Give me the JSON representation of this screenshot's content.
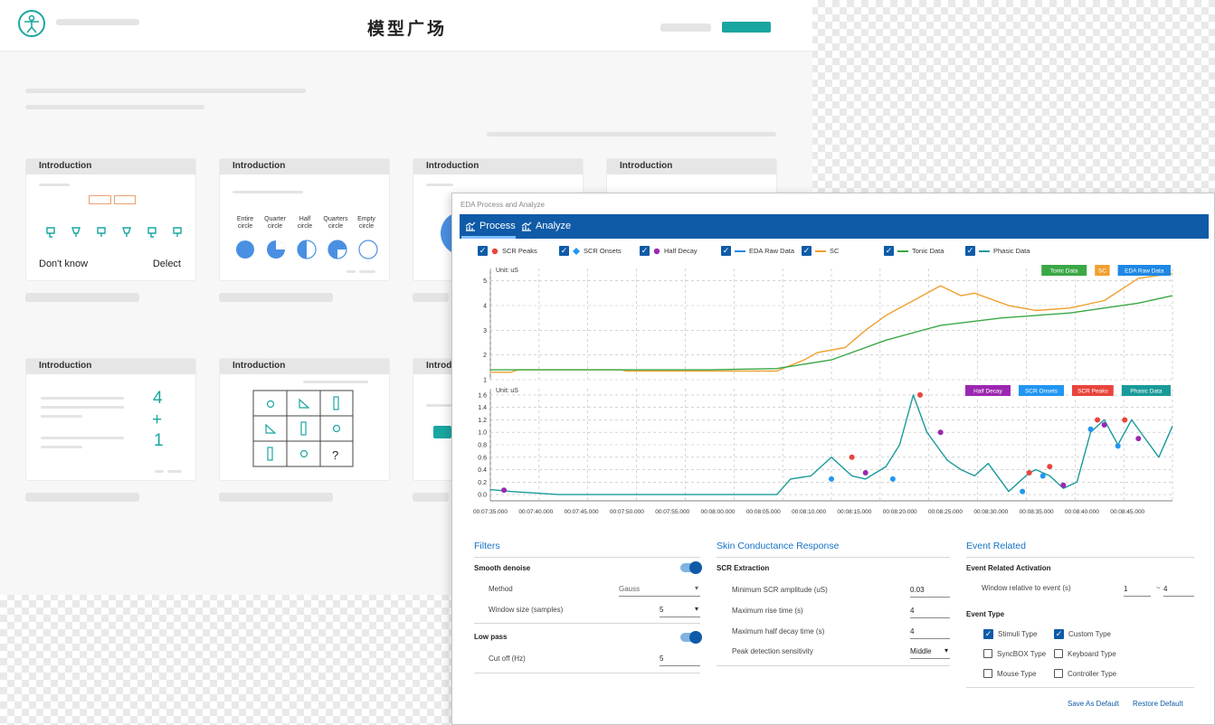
{
  "background_page": {
    "title": "模型广场",
    "cards": [
      {
        "header": "Introduction",
        "left_text": "Don't know",
        "right_text": "Delect"
      },
      {
        "header": "Introduction",
        "circle_labels": [
          "Entire circle",
          "Quarter circle",
          "Half circle",
          "Quarters circle",
          "Empty circle"
        ]
      },
      {
        "header": "Introduction"
      },
      {
        "header": "Introduction"
      },
      {
        "header": "Introduction",
        "math_top": "4",
        "math_op": "+",
        "math_bottom": "1"
      },
      {
        "header": "Introduction",
        "grid_question": "?"
      },
      {
        "header": "Introd"
      }
    ]
  },
  "window": {
    "title": "EDA Process and Analyze",
    "tabs": [
      {
        "label": "Process",
        "icon": "chart-icon"
      },
      {
        "label": "Analyze",
        "icon": "chart-icon"
      }
    ],
    "legend": [
      "SCR Peaks",
      "SCR Onsets",
      "Half Decay",
      "EDA Raw Data",
      "SC",
      "Tonic Data",
      "Phasic Data"
    ],
    "colors": {
      "accent": "#0f5ba8",
      "sc": "#f0a030",
      "tonic": "#3aa845",
      "phasic": "#1a9a9a",
      "scr_peak": "#e8453c",
      "scr_onset": "#2196f3",
      "half_decay": "#9c27b0",
      "raw": "#1e88e5"
    }
  },
  "chart_data": [
    {
      "type": "line",
      "unit_label": "Unit: uS",
      "legend_badges": [
        "Tonic Data",
        "SC",
        "EDA Raw Data"
      ],
      "ylim": [
        1,
        5.5
      ],
      "yticks": [
        "5",
        "4",
        "3",
        "2",
        "1"
      ],
      "series": [
        {
          "name": "SC",
          "x": [
            0,
            0.03,
            0.04,
            0.1,
            0.19,
            0.2,
            0.32,
            0.42,
            0.46,
            0.48,
            0.52,
            0.55,
            0.58,
            0.62,
            0.66,
            0.69,
            0.71,
            0.73,
            0.76,
            0.8,
            0.85,
            0.9,
            0.95,
            1.0
          ],
          "values": [
            1.3,
            1.3,
            1.4,
            1.4,
            1.4,
            1.35,
            1.35,
            1.35,
            1.8,
            2.1,
            2.3,
            3.0,
            3.6,
            4.2,
            4.8,
            4.4,
            4.5,
            4.3,
            4.0,
            3.8,
            3.9,
            4.2,
            5.1,
            5.3
          ]
        },
        {
          "name": "Tonic Data",
          "x": [
            0,
            0.1,
            0.2,
            0.32,
            0.42,
            0.5,
            0.58,
            0.66,
            0.75,
            0.85,
            0.95,
            1.0
          ],
          "values": [
            1.4,
            1.4,
            1.4,
            1.4,
            1.45,
            1.8,
            2.6,
            3.2,
            3.5,
            3.7,
            4.1,
            4.4
          ]
        }
      ]
    },
    {
      "type": "line",
      "unit_label": "Unit: uS",
      "legend_badges": [
        "Half Decay",
        "SCR Onsets",
        "SCR Peaks",
        "Phasic Data"
      ],
      "ylim": [
        -0.1,
        1.7
      ],
      "yticks": [
        "1.6",
        "1.4",
        "1.2",
        "1.0",
        "0.8",
        "0.6",
        "0.4",
        "0.2",
        "0.0"
      ],
      "xticks": [
        "00:07:35.000",
        "00:07:40.000",
        "00:07:45.000",
        "00:07:50.000",
        "00:07:55.000",
        "00:08:00.000",
        "00:08:05.000",
        "00:08:10.000",
        "00:08:15.000",
        "00:08:20.000",
        "00:08:25.000",
        "00:08:30.000",
        "00:08:35.000",
        "00:08:40.000",
        "00:08:45.000"
      ],
      "series": [
        {
          "name": "Phasic Data",
          "x": [
            0,
            0.03,
            0.1,
            0.2,
            0.3,
            0.42,
            0.44,
            0.47,
            0.5,
            0.53,
            0.55,
            0.58,
            0.6,
            0.62,
            0.64,
            0.66,
            0.67,
            0.69,
            0.71,
            0.73,
            0.76,
            0.79,
            0.8,
            0.82,
            0.84,
            0.86,
            0.88,
            0.9,
            0.92,
            0.94,
            0.96,
            0.98,
            1.0
          ],
          "values": [
            0.08,
            0.05,
            0.0,
            0.0,
            0.0,
            0.0,
            0.25,
            0.3,
            0.6,
            0.3,
            0.25,
            0.45,
            0.8,
            1.6,
            1.0,
            0.7,
            0.55,
            0.4,
            0.3,
            0.5,
            0.05,
            0.35,
            0.4,
            0.3,
            0.1,
            0.2,
            1.0,
            1.2,
            0.8,
            1.2,
            0.9,
            0.6,
            1.1
          ]
        },
        {
          "name": "SCR Peaks",
          "x": [
            0.53,
            0.63,
            0.79,
            0.82,
            0.89,
            0.93
          ],
          "values": [
            0.6,
            1.6,
            0.35,
            0.45,
            1.2,
            1.2
          ]
        },
        {
          "name": "SCR Onsets",
          "x": [
            0.5,
            0.59,
            0.78,
            0.81,
            0.88,
            0.92
          ],
          "values": [
            0.25,
            0.25,
            0.05,
            0.3,
            1.05,
            0.78
          ]
        },
        {
          "name": "Half Decay",
          "x": [
            0.02,
            0.55,
            0.66,
            0.84,
            0.9,
            0.95
          ],
          "values": [
            0.07,
            0.35,
            1.0,
            0.15,
            1.12,
            0.9
          ]
        }
      ]
    }
  ],
  "filters": {
    "title": "Filters",
    "smooth_label": "Smooth denoise",
    "method_label": "Method",
    "method_value": "Gauss",
    "window_label": "Window size (samples)",
    "window_value": "5",
    "lowpass_label": "Low pass",
    "cutoff_label": "Cut off (Hz)",
    "cutoff_value": "5"
  },
  "scr": {
    "title": "Skin Conductance Response",
    "extraction_label": "SCR Extraction",
    "rows": [
      {
        "label": "Minimum SCR amplitude (uS)",
        "value": "0.03"
      },
      {
        "label": "Maximum rise time (s)",
        "value": "4"
      },
      {
        "label": "Maximum half decay time (s)",
        "value": "4"
      },
      {
        "label": "Peak detection sensitivity",
        "value": "Middle"
      }
    ]
  },
  "event": {
    "title": "Event Related",
    "activation_label": "Event Related Activation",
    "window_label": "Window relative to event (s)",
    "window_from": "1",
    "window_sep": "~",
    "window_to": "4",
    "type_label": "Event Type",
    "types": [
      {
        "label": "Stimuli Type",
        "checked": true
      },
      {
        "label": "Custom Type",
        "checked": true
      },
      {
        "label": "SyncBOX Type",
        "checked": false
      },
      {
        "label": "Keyboard Type",
        "checked": false
      },
      {
        "label": "Mouse Type",
        "checked": false
      },
      {
        "label": "Controller Type",
        "checked": false
      }
    ],
    "save_default": "Save As Default",
    "restore_default": "Restore Default"
  }
}
